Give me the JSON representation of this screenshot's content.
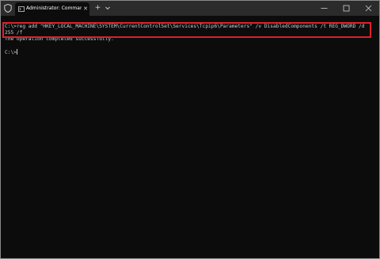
{
  "titlebar": {
    "tab_title": "Administrator: Command Pro",
    "tab_close": "✕",
    "new_tab": "+",
    "icons": {
      "shield": "shield-icon",
      "terminal": "terminal-icon",
      "dropdown": "chevron-down-icon",
      "minimize": "minimize-icon",
      "maximize": "maximize-icon",
      "close": "close-icon"
    }
  },
  "terminal": {
    "command_line_1": "C:\\>reg add \"HKEY_LOCAL_MACHINE\\SYSTEM\\CurrentControlSet\\Services\\Tcpip6\\Parameters\" /v DisabledComponents /t REG_DWORD /d",
    "command_line_2": "255 /f",
    "output": "The operation completed successfully.",
    "prompt": "C:\\>"
  },
  "colors": {
    "background": "#0c0c0c",
    "titlebar": "#2b2b2b",
    "text": "#cccccc",
    "highlight_border": "#e0202a"
  }
}
